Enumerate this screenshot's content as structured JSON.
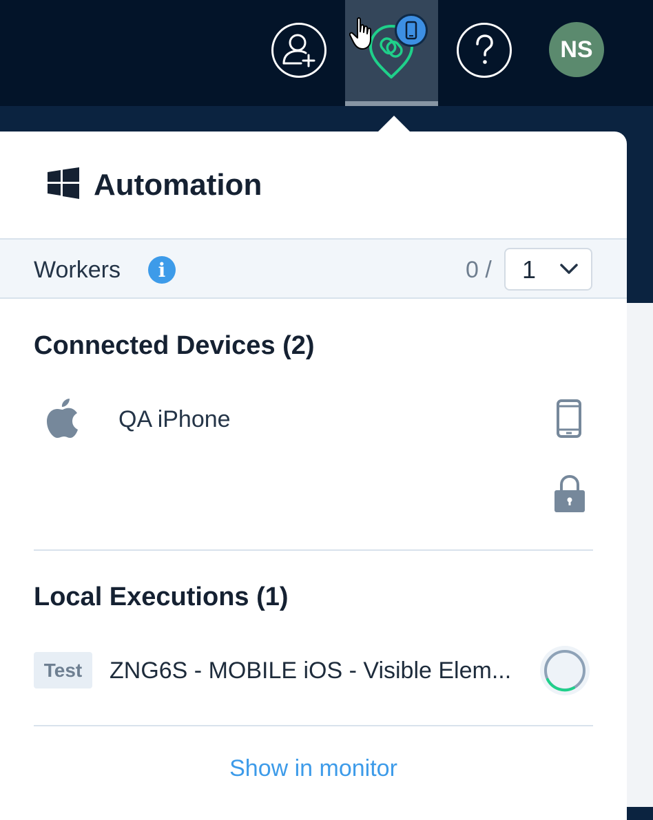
{
  "header": {
    "avatar_initials": "NS",
    "icons": [
      "add-user-icon",
      "agent-link-icon",
      "mobile-device-badge-icon",
      "help-icon",
      "pointer-cursor-icon"
    ]
  },
  "panel": {
    "title": "Automation",
    "platform_icon": "windows-icon",
    "workers": {
      "label": "Workers",
      "active": "0 /",
      "selected_max": "1"
    },
    "connected_devices": {
      "title": "Connected Devices (2)",
      "items": [
        {
          "name": "QA iPhone",
          "os_icon": "apple-icon",
          "type_icon": "phone-icon"
        },
        {
          "name": "",
          "type_icon": "lock-icon"
        }
      ]
    },
    "local_executions": {
      "title": "Local Executions (1)",
      "items": [
        {
          "badge": "Test",
          "name": "ZNG6S - MOBILE iOS - Visible Elem...",
          "status_icon": "progress-spinner-icon"
        }
      ]
    },
    "footer_link": "Show in monitor"
  },
  "colors": {
    "topbar": "#031429",
    "accent_blue": "#3d9be9",
    "agent_green": "#1fd08a",
    "avatar": "#5b8a6e"
  }
}
